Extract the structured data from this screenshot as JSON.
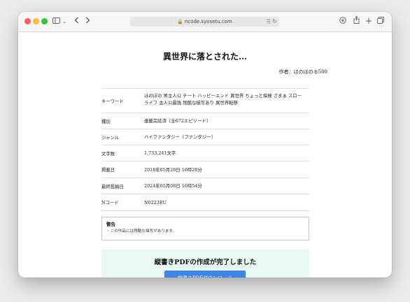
{
  "browser": {
    "url": "ncode.syosetu.com"
  },
  "novel": {
    "title": "異世界に落とされた…",
    "author_label": "作者：",
    "author": "ほのぼのる500"
  },
  "info_rows": [
    {
      "label": "キーワード",
      "value_line1": "ほのぼの 男主人公 チート ハッピーエンド 異世界 ちょっと探検 ざまぁ スロー",
      "value_line2": "ライフ 主人公最強 残酷な描写あり 異世界転移"
    },
    {
      "label": "種別",
      "value": "連載完結済〔全672エピソード〕"
    },
    {
      "label": "ジャンル",
      "value": "ハイファンタジー〔ファンタジー〕"
    },
    {
      "label": "文字数",
      "value": "1,733,241文字"
    },
    {
      "label": "掲載日",
      "value": "2018年05月26日 16時28分"
    },
    {
      "label": "最終投稿日",
      "value": "2024年05月08日 16時54分"
    },
    {
      "label": "Nコード",
      "value": "N0223EU"
    }
  ],
  "warning": {
    "title": "警告",
    "body": "・この作品には残酷な描写があります。"
  },
  "pdf": {
    "title": "縦書きPDFの作成が完了しました",
    "button_label": "縦書きPDFダウンロード"
  }
}
